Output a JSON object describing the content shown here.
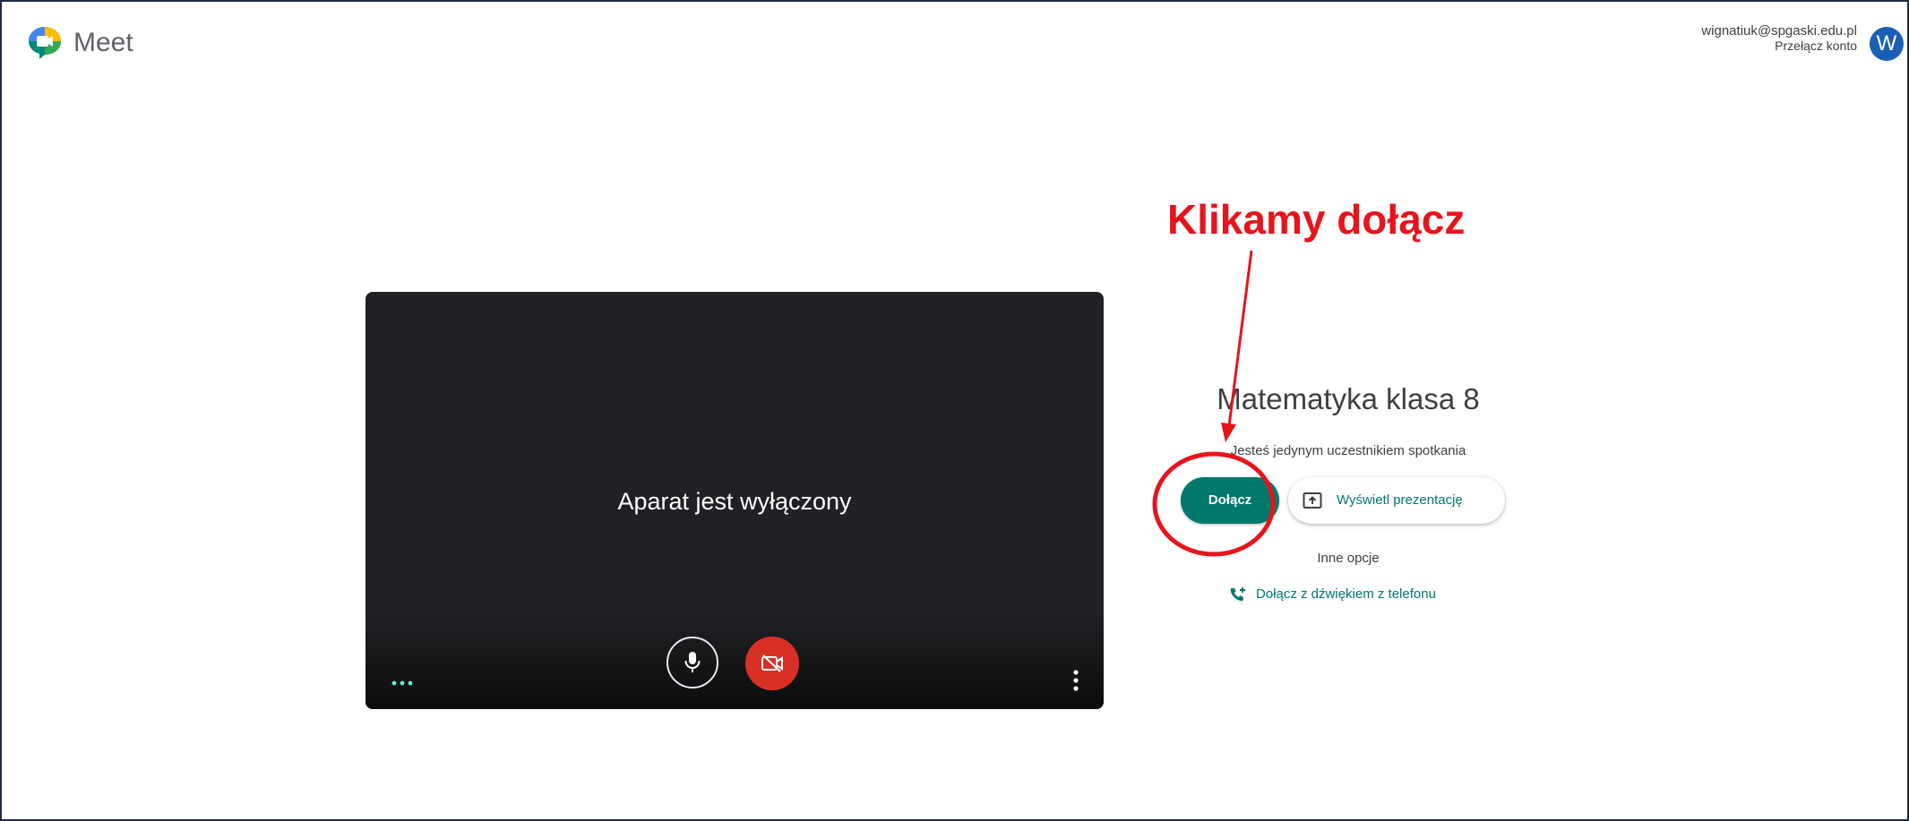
{
  "header": {
    "app_name": "Meet",
    "account_email": "wignatiuk@spgaski.edu.pl",
    "switch_account_label": "Przełącz konto",
    "avatar_letter": "W",
    "logo_icon": "meet-logo-icon"
  },
  "preview": {
    "camera_off_text": "Aparat jest wyłączony",
    "mic_icon": "microphone-icon",
    "camera_icon": "camera-off-icon",
    "effects_icon": "dots-icon",
    "more_icon": "more-vert-icon"
  },
  "meeting": {
    "title": "Matematyka klasa 8",
    "status": "Jesteś jedynym uczestnikiem spotkania",
    "join_label": "Dołącz",
    "present_label": "Wyświetl prezentację",
    "other_options_label": "Inne opcje",
    "phone_join_label": "Dołącz z dźwiękiem z telefonu"
  },
  "annotation": {
    "text": "Klikamy dołącz",
    "color": "#e8141b"
  },
  "colors": {
    "accent": "#00796b",
    "camera_off_red": "#d93025",
    "preview_bg": "#202124",
    "avatar_bg": "#1a5fb4"
  }
}
